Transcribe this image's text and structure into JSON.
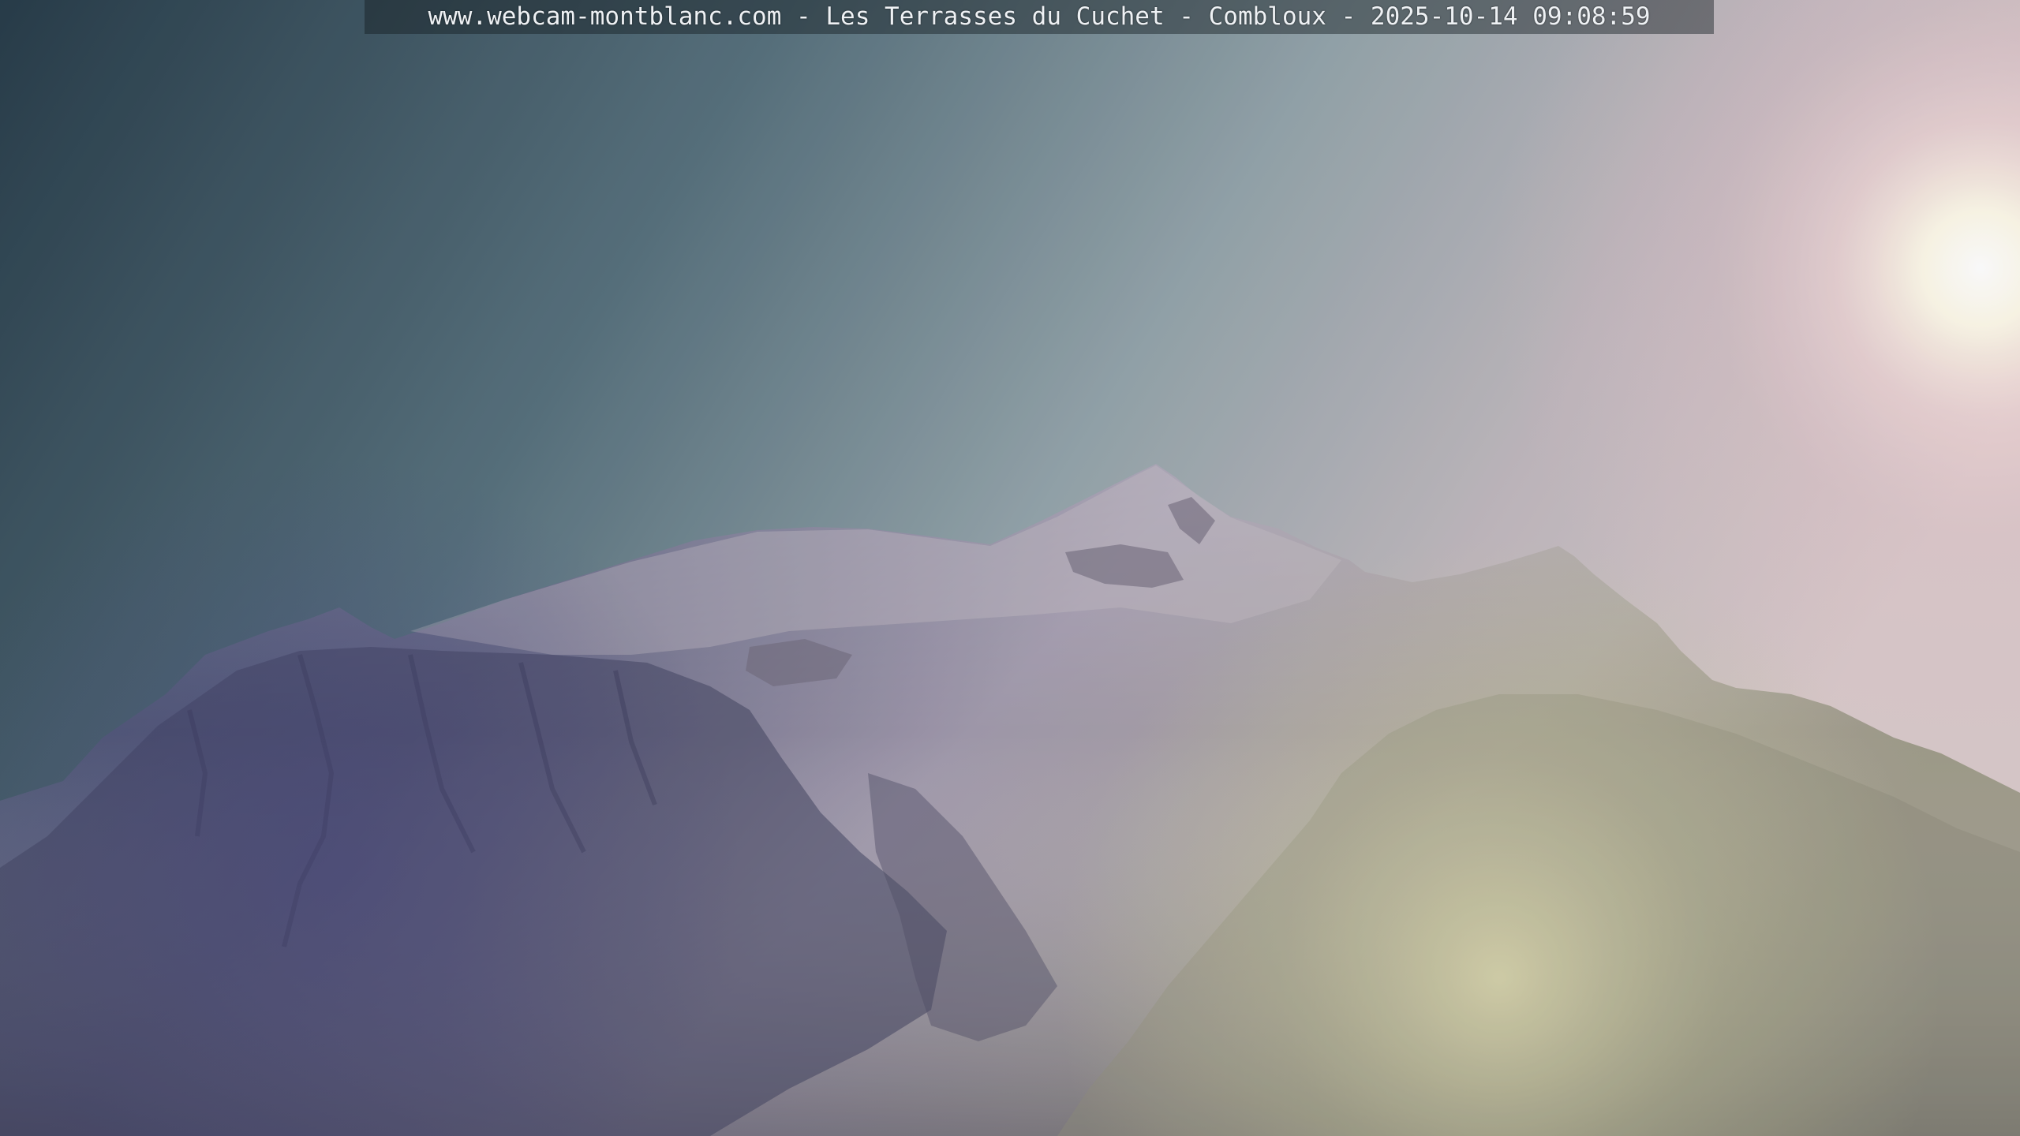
{
  "webcam": {
    "caption": "www.webcam-montblanc.com - Les Terrasses du Cuchet - Combloux - 2025-10-14 09:08:59"
  },
  "scene": {
    "subject": "mountain-peaks",
    "light_source": "sun",
    "colors": {
      "sky_dark": "#1f3340",
      "sky_mid": "#6f8690",
      "sky_light": "#b8b6bc",
      "sun_glow": "#fff8e0",
      "sun_halo": "#f0c4cc",
      "mountain_snow": "#b3aeba",
      "mountain_shadow": "#3a3f58",
      "lens_flare": "#d8d6a8"
    }
  }
}
